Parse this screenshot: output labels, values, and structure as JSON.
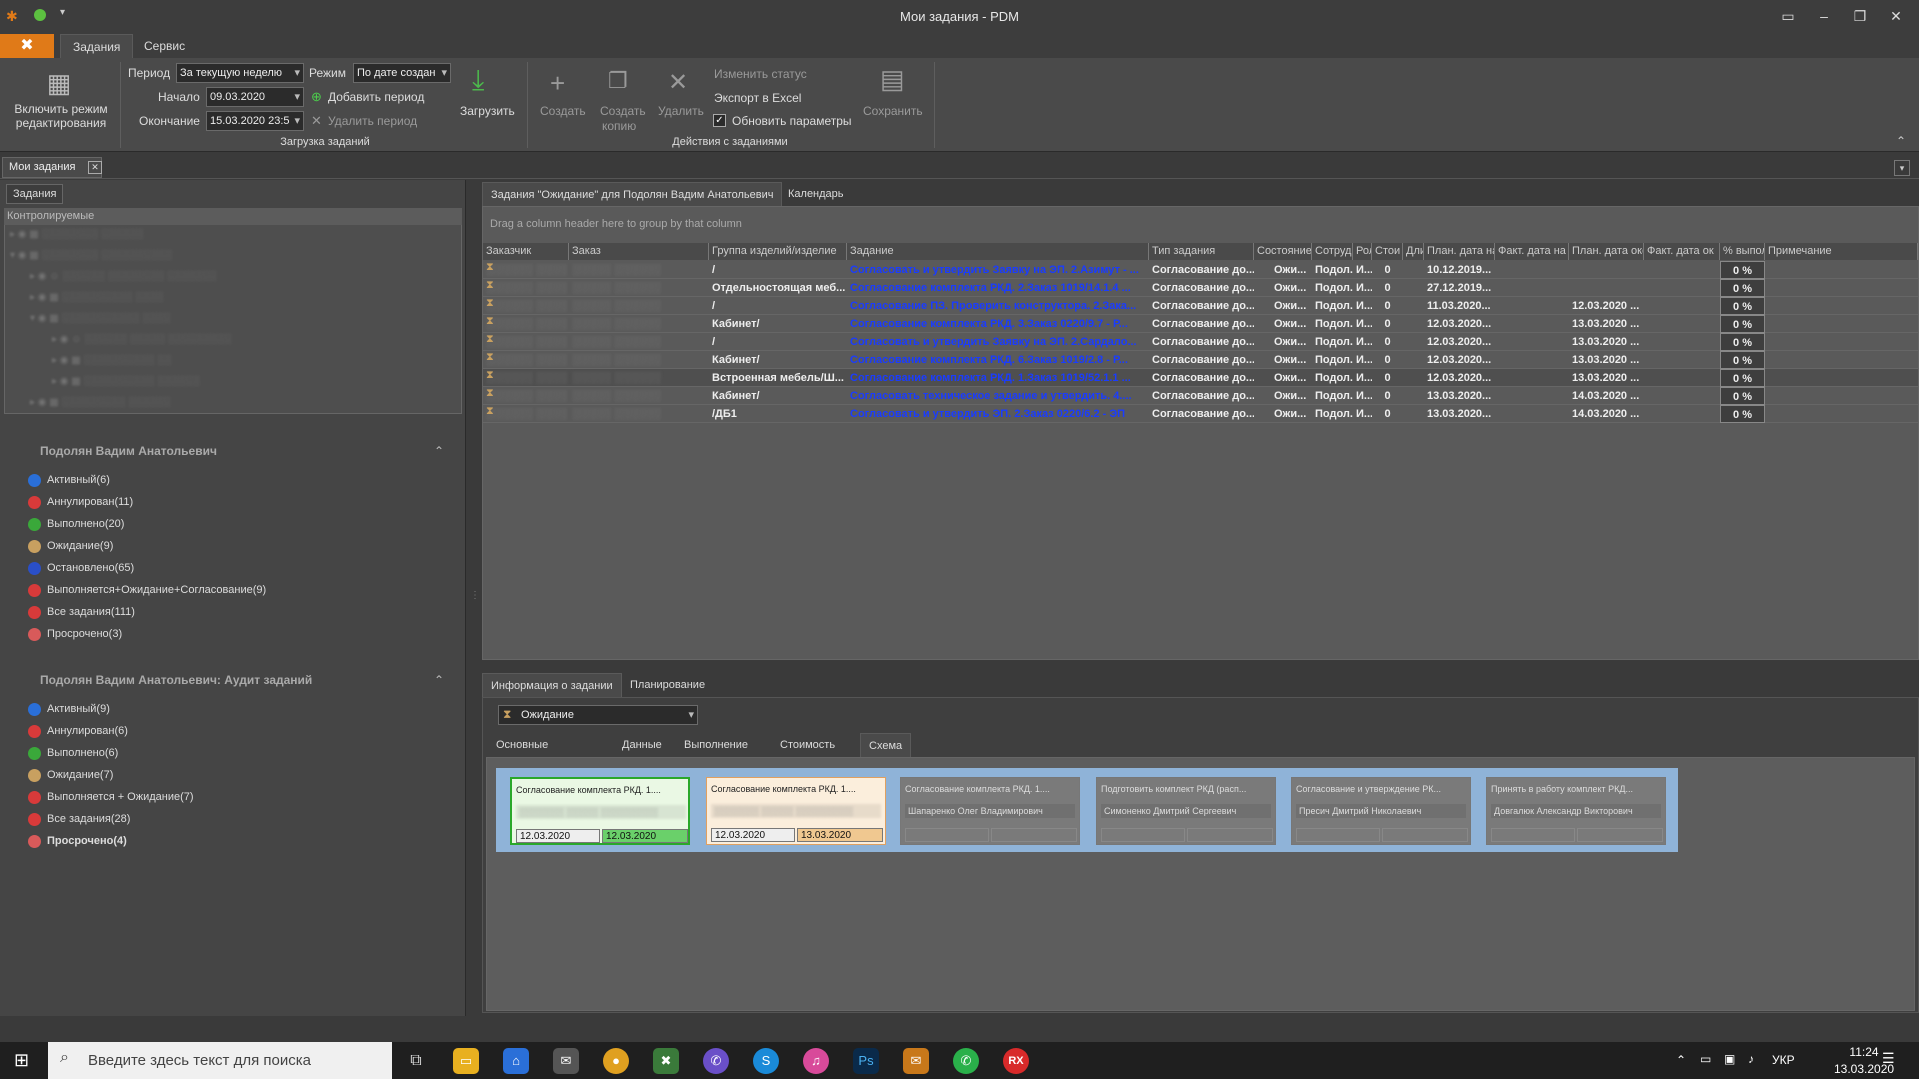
{
  "window": {
    "title": "Мои задания - PDM"
  },
  "ribbon_tabs": [
    "Задания",
    "Сервис"
  ],
  "ribbon": {
    "edit_mode": "Включить режим редактирования",
    "period_label": "Период",
    "period_value": "За текущую неделю",
    "mode_label": "Режим",
    "mode_value": "По дате создан",
    "start_label": "Начало",
    "start_value": "09.03.2020",
    "end_label": "Окончание",
    "end_value": "15.03.2020 23:5",
    "add_period": "Добавить период",
    "remove_period": "Удалить период",
    "load": "Загрузить",
    "load_group": "Загрузка заданий",
    "create": "Создать",
    "create_copy_1": "Создать",
    "create_copy_2": "копию",
    "delete": "Удалить",
    "change_status": "Изменить статус",
    "export_excel": "Экспорт в Excel",
    "update_params": "Обновить параметры",
    "save": "Сохранить",
    "actions_group": "Действия с заданиями"
  },
  "doc_tab": "Мои задания",
  "left": {
    "tab": "Задания",
    "tree_header": "Контролируемые",
    "section1_title": "Подолян Вадим Анатольевич",
    "section1_items": [
      {
        "label": "Активный(6)",
        "color": "#2a6fd8"
      },
      {
        "label": "Аннулирован(11)",
        "color": "#d83a3a"
      },
      {
        "label": "Выполнено(20)",
        "color": "#3aa83a"
      },
      {
        "label": "Ожидание(9)",
        "color": "#c8a060"
      },
      {
        "label": "Остановлено(65)",
        "color": "#2a4fc8"
      },
      {
        "label": "Выполняется+Ожидание+Согласование(9)",
        "color": "#d83a3a"
      },
      {
        "label": "Все задания(111)",
        "color": "#d83a3a"
      },
      {
        "label": "Просрочено(3)",
        "color": "#d85a5a"
      }
    ],
    "section2_title": "Подолян Вадим Анатольевич: Аудит заданий",
    "section2_items": [
      {
        "label": "Активный(9)",
        "color": "#2a6fd8"
      },
      {
        "label": "Аннулирован(6)",
        "color": "#d83a3a"
      },
      {
        "label": "Выполнено(6)",
        "color": "#3aa83a"
      },
      {
        "label": "Ожидание(7)",
        "color": "#c8a060"
      },
      {
        "label": "Выполняется + Ожидание(7)",
        "color": "#d83a3a"
      },
      {
        "label": "Все задания(28)",
        "color": "#d83a3a"
      },
      {
        "label": "Просрочено(4)",
        "color": "#d85a5a"
      }
    ]
  },
  "grid": {
    "tab_main": "Задания \"Ожидание\" для Подолян Вадим Анатольевич",
    "tab_calendar": "Календарь",
    "group_hint": "Drag a column header here to group by that column",
    "columns": [
      "Заказчик",
      "Заказ",
      "Группа изделий/изделие",
      "Задание",
      "Тип задания",
      "Состояние",
      "Сотрудни",
      "Рол",
      "Стои",
      "Дли",
      "План. дата на",
      "Факт. дата на",
      "План. дата око",
      "Факт. дата ок",
      "% выпол",
      "Примечание"
    ],
    "rows": [
      {
        "group": "/",
        "task": "Согласовать и утвердить Заявку на ЭП. 2.Азимут - ...",
        "type": "Согласование до...",
        "state": "Ожи...",
        "emp": "Подол...",
        "role": "И...",
        "cost": "0",
        "plan_start": "10.12.2019...",
        "plan_end": "",
        "pct": "0 %"
      },
      {
        "group": "Отдельностоящая меб...",
        "task": "Согласование комплекта РКД. 2.Заказ 1019/14.1.4 ...",
        "type": "Согласование до...",
        "state": "Ожи...",
        "emp": "Подол...",
        "role": "И...",
        "cost": "0",
        "plan_start": "27.12.2019...",
        "plan_end": "",
        "pct": "0 %"
      },
      {
        "group": "/",
        "task": "Согласование ПЗ. Проверить конструктора. 2.Зака...",
        "type": "Согласование до...",
        "state": "Ожи...",
        "emp": "Подол...",
        "role": "И...",
        "cost": "0",
        "plan_start": "11.03.2020...",
        "plan_end": "12.03.2020 ...",
        "pct": "0 %"
      },
      {
        "group": "Кабинет/",
        "task": "Согласование комплекта РКД. 3.Заказ 0220/9.7 - Р...",
        "type": "Согласование до...",
        "state": "Ожи...",
        "emp": "Подол...",
        "role": "И...",
        "cost": "0",
        "plan_start": "12.03.2020...",
        "plan_end": "13.03.2020 ...",
        "pct": "0 %"
      },
      {
        "group": "/",
        "task": "Согласовать и утвердить Заявку на ЭП. 2.Сардало...",
        "type": "Согласование до...",
        "state": "Ожи...",
        "emp": "Подол...",
        "role": "И...",
        "cost": "0",
        "plan_start": "12.03.2020...",
        "plan_end": "13.03.2020 ...",
        "pct": "0 %"
      },
      {
        "group": "Кабинет/",
        "task": "Согласование комплекта РКД. 6.Заказ 1019/2.8 - Р...",
        "type": "Согласование до...",
        "state": "Ожи...",
        "emp": "Подол...",
        "role": "И...",
        "cost": "0",
        "plan_start": "12.03.2020...",
        "plan_end": "13.03.2020 ...",
        "pct": "0 %"
      },
      {
        "group": "Встроенная мебель/Ш...",
        "task": "Согласование комплекта РКД. 1.Заказ 1019/52.1.1 ...",
        "type": "Согласование до...",
        "state": "Ожи...",
        "emp": "Подол...",
        "role": "И...",
        "cost": "0",
        "plan_start": "12.03.2020...",
        "plan_end": "13.03.2020 ...",
        "pct": "0 %"
      },
      {
        "group": "Кабинет/",
        "task": "Согласовать техническое задание и утвердить. 4....",
        "type": "Согласование до...",
        "state": "Ожи...",
        "emp": "Подол...",
        "role": "И...",
        "cost": "0",
        "plan_start": "13.03.2020...",
        "plan_end": "14.03.2020 ...",
        "pct": "0 %"
      },
      {
        "group": "/ДБ1",
        "task": "Согласовать и утвердить ЭП. 2.Заказ 0220/6.2 - ЭП",
        "type": "Согласование до...",
        "state": "Ожи...",
        "emp": "Подол...",
        "role": "И...",
        "cost": "0",
        "plan_start": "13.03.2020...",
        "plan_end": "14.03.2020 ...",
        "pct": "0 %"
      }
    ]
  },
  "info": {
    "tab_info": "Информация о задании",
    "tab_planning": "Планирование",
    "state_value": "Ожидание",
    "subtabs": [
      "Основные данные",
      "Данные БП",
      "Выполнение",
      "Стоимость",
      "Схема БП"
    ],
    "cards": [
      {
        "title": "Согласование комплекта РКД. 1....",
        "person": "",
        "d1": "12.03.2020",
        "d2": "12.03.2020"
      },
      {
        "title": "Согласование комплекта РКД. 1....",
        "person": "",
        "d1": "12.03.2020",
        "d2": "13.03.2020"
      },
      {
        "title": "Согласование комплекта РКД. 1....",
        "person": "Шапаренко Олег Владимирович",
        "d1": "",
        "d2": ""
      },
      {
        "title": "Подготовить комплект РКД (расп...",
        "person": "Симоненко Дмитрий Сергеевич",
        "d1": "",
        "d2": ""
      },
      {
        "title": "Согласование и утверждение РК...",
        "person": "Пресич Дмитрий Николаевич",
        "d1": "",
        "d2": ""
      },
      {
        "title": "Принять в работу комплект РКД...",
        "person": "Довгалюк Александр Викторович",
        "d1": "",
        "d2": ""
      }
    ]
  },
  "taskbar": {
    "search_placeholder": "Введите здесь текст для поиска",
    "lang": "УКР",
    "time": "11:24",
    "date": "13.03.2020"
  }
}
